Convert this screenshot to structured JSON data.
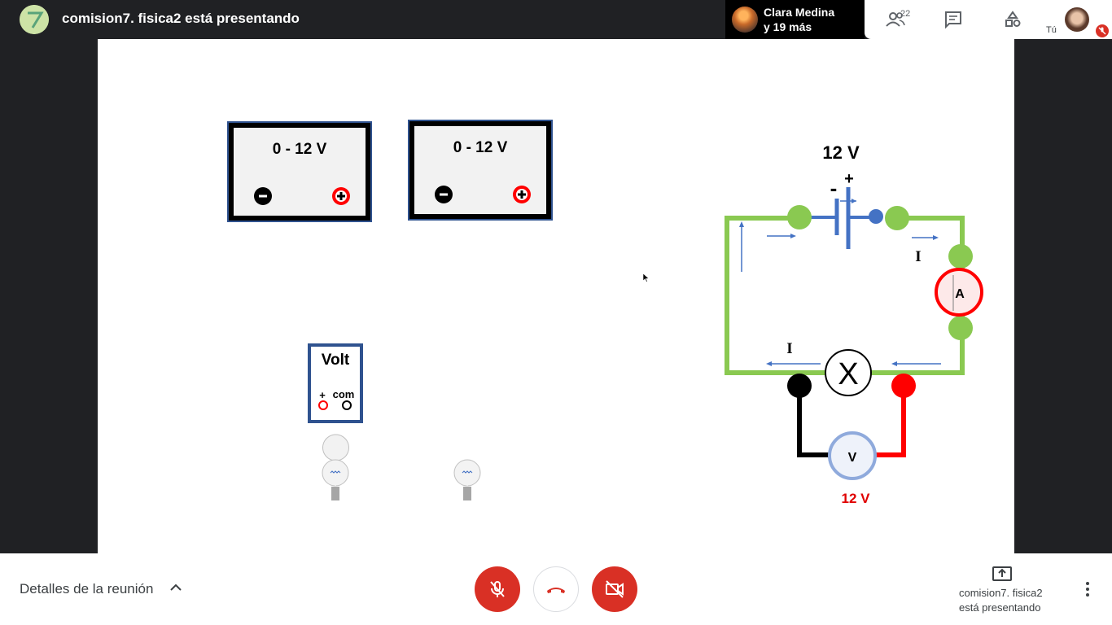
{
  "header": {
    "meeting_title": "comision7. fisica2 está presentando",
    "logo_text": "7",
    "presenter_name": "Clara Medina",
    "presenter_others": "y 19 más",
    "participants_count": "22",
    "self_label": "Tú"
  },
  "slide": {
    "power_supply_1_label": "0 - 12 V",
    "power_supply_2_label": "0 - 12 V",
    "voltmeter_label": "Volt",
    "voltmeter_plus": "+",
    "voltmeter_com": "com",
    "battery_label": "12 V",
    "battery_minus": "-",
    "battery_plus": "+",
    "current_label_top": "I",
    "current_label_bottom": "I",
    "ammeter_label": "A",
    "load_label": "X",
    "voltmeter_circle_label": "V",
    "voltage_reading": "12 V"
  },
  "footer": {
    "meeting_details": "Detalles de la reunión",
    "presenting_line1": "comision7. fisica2",
    "presenting_line2": "está presentando"
  },
  "colors": {
    "wire_green": "#8ac951",
    "wire_red": "#ff0000",
    "battery_blue": "#4472c4",
    "end_call_red": "#d93025"
  },
  "icons": {
    "mic": "mic-off-icon",
    "hangup": "call-end-icon",
    "camera": "videocam-off-icon",
    "participants": "people-icon",
    "chat": "chat-icon",
    "activities": "shapes-icon",
    "present": "present-to-all-icon",
    "more": "more-vert-icon"
  }
}
